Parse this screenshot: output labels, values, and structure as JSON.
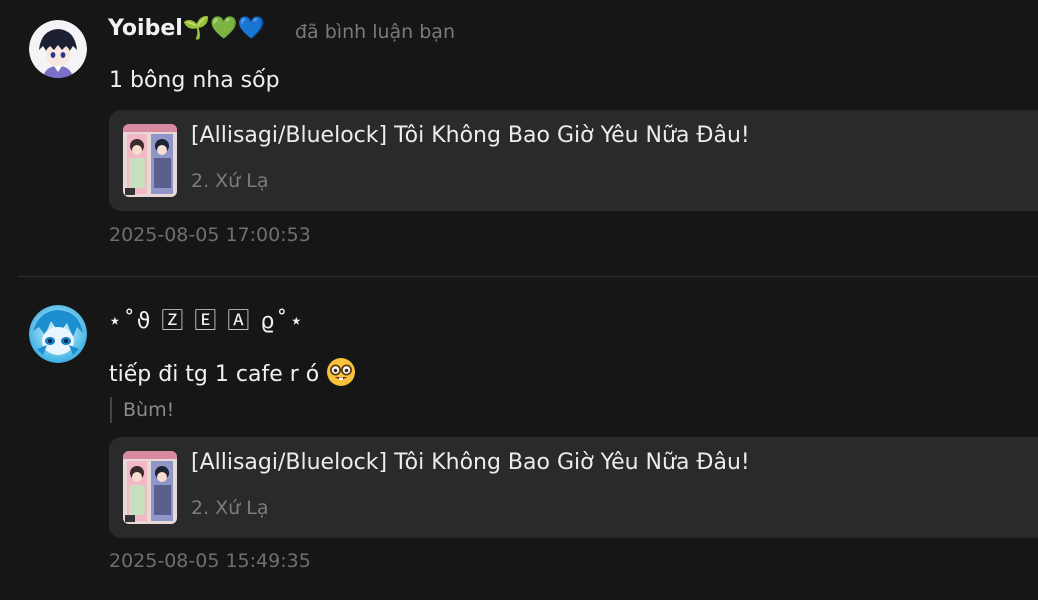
{
  "comments": [
    {
      "username": "Yoibel🌱💚💙",
      "action": "đã bình luận bạn",
      "body": "1 bông nha sốp",
      "card": {
        "title": "[Allisagi/Bluelock] Tôi Không Bao Giờ Yêu Nữa Đâu!",
        "subtitle": "2. Xứ Lạ"
      },
      "timestamp": "2025-08-05 17:00:53"
    },
    {
      "username": "⋆˚ϑ 🅉 🄴 🄰 ϱ˚⋆",
      "body": "tiếp đi tg 1 cafe r ó",
      "body_emoji": "nerd-face-emoji",
      "quote": "Bùm!",
      "card": {
        "title": "[Allisagi/Bluelock] Tôi Không Bao Giờ Yêu Nữa Đâu!",
        "subtitle": "2. Xứ Lạ"
      },
      "timestamp": "2025-08-05 15:49:35"
    }
  ],
  "colors": {
    "background": "#161616",
    "card_background": "#2a2a2a",
    "muted_text": "#7a7a7a",
    "divider": "#2f2f2f"
  }
}
